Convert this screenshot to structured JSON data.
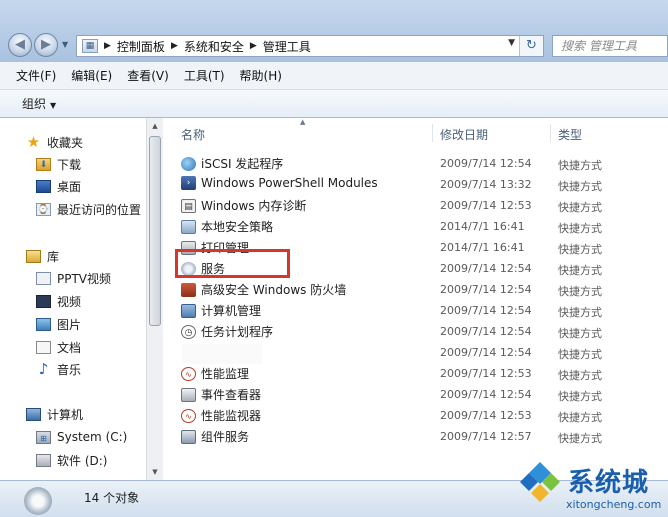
{
  "address_bar": {
    "crumbs": [
      "控制面板",
      "系统和安全",
      "管理工具"
    ],
    "search_placeholder": "搜索 管理工具"
  },
  "menu": {
    "items": [
      "文件(F)",
      "编辑(E)",
      "查看(V)",
      "工具(T)",
      "帮助(H)"
    ]
  },
  "toolbar": {
    "organize_label": "组织"
  },
  "nav_pane": {
    "favorites": {
      "label": "收藏夹",
      "items": [
        "下载",
        "桌面",
        "最近访问的位置"
      ]
    },
    "libraries": {
      "label": "库",
      "items": [
        "PPTV视频",
        "视频",
        "图片",
        "文档",
        "音乐"
      ]
    },
    "computer": {
      "label": "计算机",
      "items": [
        "System (C:)",
        "软件 (D:)"
      ]
    }
  },
  "file_list": {
    "columns": [
      "名称",
      "修改日期",
      "类型"
    ],
    "rows": [
      {
        "name": "iSCSI 发起程序",
        "date": "2009/7/14 12:54",
        "type": "快捷方式",
        "icon": "iscsi-globe-icon"
      },
      {
        "name": "Windows PowerShell Modules",
        "date": "2009/7/14 13:32",
        "type": "快捷方式",
        "icon": "powershell-icon"
      },
      {
        "name": "Windows 内存诊断",
        "date": "2009/7/14 12:53",
        "type": "快捷方式",
        "icon": "memory-diagnostic-icon"
      },
      {
        "name": "本地安全策略",
        "date": "2014/7/1 16:41",
        "type": "快捷方式",
        "icon": "security-policy-icon"
      },
      {
        "name": "打印管理",
        "date": "2014/7/1 16:41",
        "type": "快捷方式",
        "icon": "print-management-icon"
      },
      {
        "name": "服务",
        "date": "2009/7/14 12:54",
        "type": "快捷方式",
        "icon": "services-gear-icon"
      },
      {
        "name": "高级安全 Windows 防火墙",
        "date": "2009/7/14 12:54",
        "type": "快捷方式",
        "icon": "firewall-icon"
      },
      {
        "name": "计算机管理",
        "date": "2009/7/14 12:54",
        "type": "快捷方式",
        "icon": "computer-management-icon"
      },
      {
        "name": "任务计划程序",
        "date": "2009/7/14 12:54",
        "type": "快捷方式",
        "icon": "task-scheduler-icon"
      },
      {
        "name": "",
        "date": "2009/7/14 12:54",
        "type": "快捷方式",
        "icon": ""
      },
      {
        "name": "性能监理",
        "date": "2009/7/14 12:53",
        "type": "快捷方式",
        "icon": "performance-icon"
      },
      {
        "name": "事件查看器",
        "date": "2009/7/14 12:54",
        "type": "快捷方式",
        "icon": "event-viewer-icon"
      },
      {
        "name": "性能监视器",
        "date": "2009/7/14 12:53",
        "type": "快捷方式",
        "icon": "performance-monitor-icon"
      },
      {
        "name": "组件服务",
        "date": "2009/7/14 12:57",
        "type": "快捷方式",
        "icon": "component-services-icon"
      }
    ]
  },
  "status": {
    "count_text": "14 个对象"
  },
  "watermark": {
    "title": "系统城",
    "url": "xitongcheng.com"
  },
  "colors": {
    "highlight_box": "#d8362c",
    "watermark_blue": "#1a5fae"
  }
}
